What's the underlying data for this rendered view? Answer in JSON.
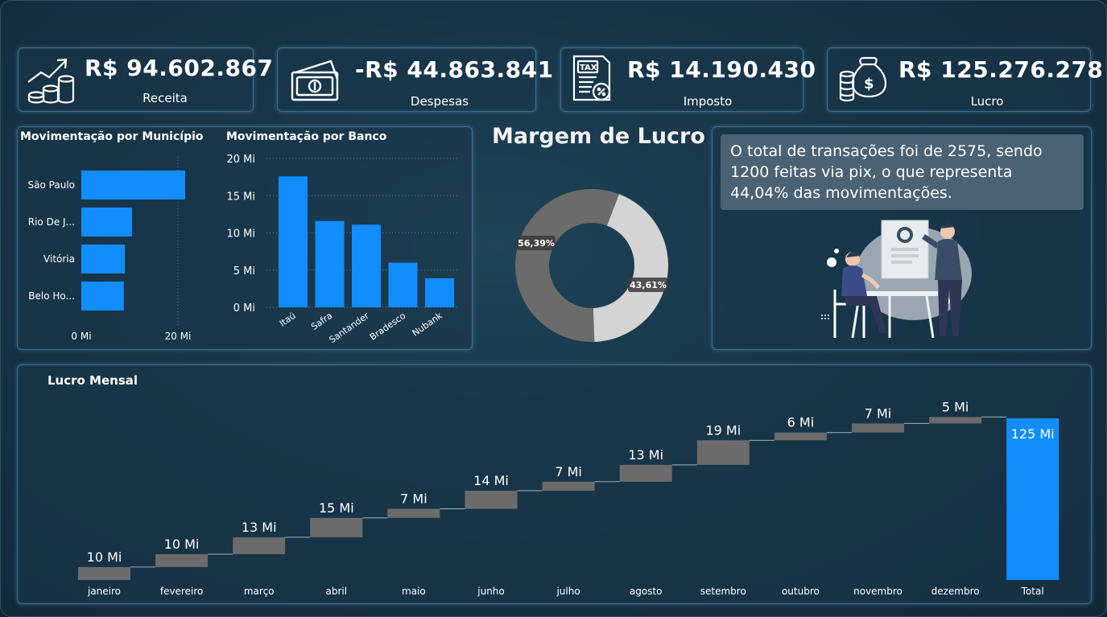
{
  "kpis": [
    {
      "value": "R$ 94.602.867",
      "label": "Receita",
      "icon": "revenue-chart-coins-icon"
    },
    {
      "value": "-R$ 44.863.841",
      "label": "Despesas",
      "icon": "money-bills-icon"
    },
    {
      "value": "R$ 14.190.430",
      "label": "Imposto",
      "icon": "tax-document-icon"
    },
    {
      "value": "R$ 125.276.278",
      "label": "Lucro",
      "icon": "money-bag-coins-icon"
    }
  ],
  "insight": {
    "text": "O total de transações foi de 2575, sendo 1200 feitas via pix, o que representa 44,04% das movimentações."
  },
  "colors": {
    "accent": "#118dff",
    "waterfall_bar": "#6b6b6b",
    "donut_dark": "#6b6b6b",
    "donut_light": "#d4d4d4"
  },
  "chart_data": [
    {
      "type": "bar",
      "orientation": "horizontal",
      "title": "Movimentação por Município",
      "categories": [
        "São Paulo",
        "Rio De J...",
        "Vitória",
        "Belo Ho..."
      ],
      "values": [
        21.5,
        10.5,
        9,
        8.8
      ],
      "xlim": [
        0,
        22
      ],
      "x_ticks": [
        "0 Mi",
        "20 Mi"
      ]
    },
    {
      "type": "bar",
      "title": "Movimentação por Banco",
      "categories": [
        "Itaú",
        "Safra",
        "Santander",
        "Bradesco",
        "Nubank"
      ],
      "values": [
        17.6,
        11.6,
        11.1,
        6,
        3.9
      ],
      "ylim": [
        0,
        20
      ],
      "y_ticks": [
        "0 Mi",
        "5 Mi",
        "10 Mi",
        "15 Mi",
        "20 Mi"
      ],
      "y_tick_values": [
        0,
        5,
        10,
        15,
        20
      ]
    },
    {
      "type": "pie",
      "donut": true,
      "title": "Margem de Lucro",
      "slices": [
        {
          "label": "56,39%",
          "value": 56.39
        },
        {
          "label": "43,61%",
          "value": 43.61
        }
      ]
    },
    {
      "type": "bar",
      "subtype": "waterfall",
      "title": "Lucro Mensal",
      "categories": [
        "janeiro",
        "fevereiro",
        "março",
        "abril",
        "maio",
        "junho",
        "julho",
        "agosto",
        "setembro",
        "outubro",
        "novembro",
        "dezembro"
      ],
      "values": [
        10,
        10,
        13,
        15,
        7,
        14,
        7,
        13,
        19,
        6,
        7,
        5
      ],
      "labels": [
        "10 Mi",
        "10 Mi",
        "13 Mi",
        "15 Mi",
        "7 Mi",
        "14 Mi",
        "7 Mi",
        "13 Mi",
        "19 Mi",
        "6 Mi",
        "7 Mi",
        "5 Mi"
      ],
      "total": {
        "category": "Total",
        "value": 125,
        "label": "125 Mi"
      }
    }
  ]
}
